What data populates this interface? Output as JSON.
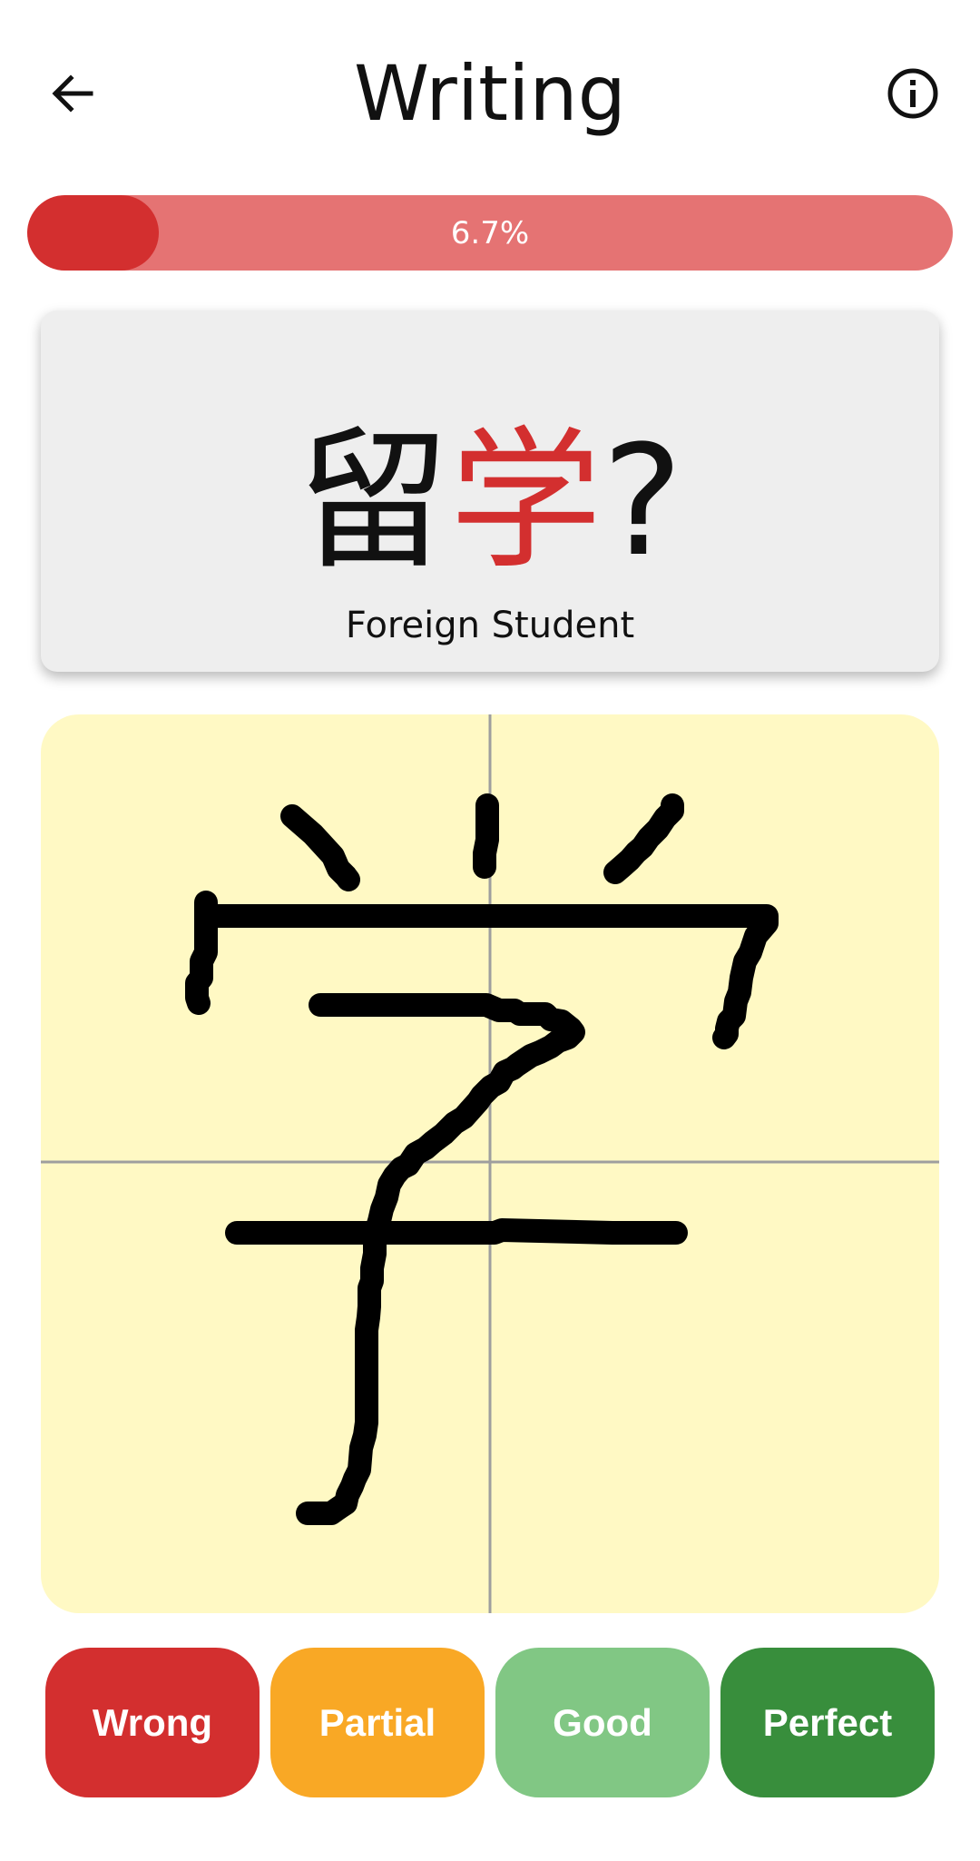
{
  "header": {
    "title": "Writing",
    "back_icon": "arrow-left-icon",
    "info_icon": "info-circle-icon"
  },
  "progress": {
    "value_percent": 6.7,
    "label": "6.7%",
    "fill_color": "#d32f2f",
    "track_color": "#e57373"
  },
  "prompt": {
    "prefix": "留",
    "target": "学",
    "suffix": "?",
    "meaning": "Foreign Student",
    "target_color": "#d32f2f"
  },
  "canvas": {
    "background_color": "#fff9c4",
    "ink_color": "#000000",
    "guide_lines": "cross"
  },
  "grading": {
    "buttons": [
      {
        "label": "Wrong",
        "color": "#d32f2f"
      },
      {
        "label": "Partial",
        "color": "#f9a825"
      },
      {
        "label": "Good",
        "color": "#81c784"
      },
      {
        "label": "Perfect",
        "color": "#388e3c"
      }
    ]
  }
}
